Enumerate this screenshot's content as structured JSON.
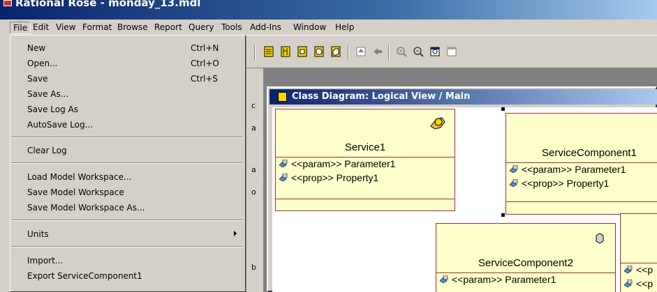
{
  "window": {
    "title": "Rational Rose - monday_13.mdl"
  },
  "menubar": [
    "File",
    "Edit",
    "View",
    "Format",
    "Browse",
    "Report",
    "Query",
    "Tools",
    "Add-Ins",
    "Window",
    "Help"
  ],
  "file_menu": {
    "items": [
      {
        "label": "New",
        "shortcut": "Ctrl+N"
      },
      {
        "label": "Open...",
        "shortcut": "Ctrl+O"
      },
      {
        "label": "Save",
        "shortcut": "Ctrl+S"
      },
      {
        "label": "Save As...",
        "shortcut": ""
      },
      {
        "label": "Save Log As",
        "shortcut": ""
      },
      {
        "label": "AutoSave Log...",
        "shortcut": ""
      },
      {
        "label": "Clear Log",
        "shortcut": ""
      },
      {
        "label": "Load Model Workspace...",
        "shortcut": ""
      },
      {
        "label": "Save Model Workspace",
        "shortcut": ""
      },
      {
        "label": "Save Model Workspace As...",
        "shortcut": ""
      },
      {
        "label": "Units",
        "shortcut": ""
      },
      {
        "label": "Import...",
        "shortcut": ""
      },
      {
        "label": "Export ServiceComponent1",
        "shortcut": ""
      }
    ]
  },
  "diagram": {
    "title": "Class Diagram: Logical View / Main",
    "classes": [
      {
        "name": "Service1",
        "attributes": [
          "<<param>> Parameter1",
          "<<prop>> Property1"
        ]
      },
      {
        "name": "ServiceComponent1",
        "attributes": [
          "<<param>> Parameter1",
          "<<prop>> Property1"
        ]
      },
      {
        "name": "ServiceComponent2",
        "attributes": [
          "<<param>> Parameter1"
        ]
      },
      {
        "name": "",
        "attributes": [
          "<<p",
          "<<p"
        ]
      }
    ]
  },
  "colors": {
    "class_fill": "#ffffcc",
    "class_border": "#993333",
    "title_active": "#0a246a"
  }
}
